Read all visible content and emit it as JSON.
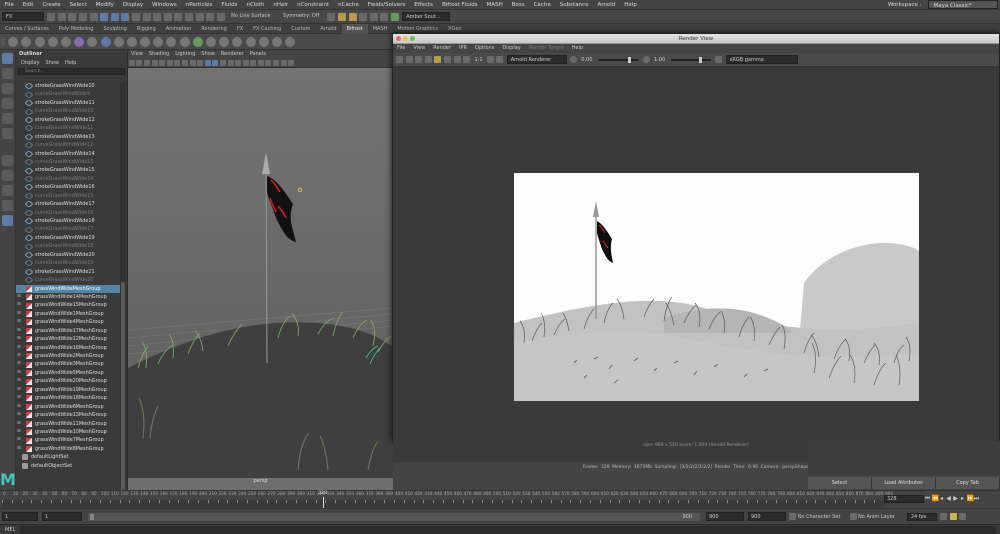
{
  "menubar": {
    "items": [
      "File",
      "Edit",
      "Create",
      "Select",
      "Modify",
      "Display",
      "Windows",
      "nParticles",
      "Fluids",
      "nCloth",
      "nHair",
      "nConstraint",
      "nCache",
      "Fields/Solvers",
      "Effects",
      "Bifrost Fluids",
      "MASH",
      "Boss",
      "Cache",
      "Substance",
      "Arnold",
      "Help"
    ],
    "workspace_label": "Workspace :",
    "workspace_value": "Maya Classic*"
  },
  "statusline": {
    "menuset": "FX",
    "live_surface": "No Live Surface",
    "symmetry": "Symmetry: Off",
    "camera_field": "Amber Sout..."
  },
  "shelf": {
    "tabs": [
      "Curves / Surfaces",
      "Poly Modeling",
      "Sculpting",
      "Rigging",
      "Animation",
      "Rendering",
      "FX",
      "FX Caching",
      "Custom",
      "Arnold",
      "Bifrost",
      "MASH",
      "Motion Graphics",
      "XGen"
    ],
    "active_tab": "Bifrost"
  },
  "outliner": {
    "title": "Outliner",
    "menu": [
      "Display",
      "Show",
      "Help"
    ],
    "search_placeholder": "Search...",
    "items": [
      {
        "label": "strokeGrassWindWide10",
        "kind": "curve",
        "dim": false
      },
      {
        "label": "curveGrassWindWide9",
        "kind": "curve",
        "dim": true
      },
      {
        "label": "strokeGrassWindWide11",
        "kind": "curve",
        "dim": false
      },
      {
        "label": "curveGrassWindWide10",
        "kind": "curve",
        "dim": true
      },
      {
        "label": "strokeGrassWindWide12",
        "kind": "curve",
        "dim": false
      },
      {
        "label": "curveGrassWindWide11",
        "kind": "curve",
        "dim": true
      },
      {
        "label": "strokeGrassWindWide13",
        "kind": "curve",
        "dim": false
      },
      {
        "label": "curveGrassWindWide12",
        "kind": "curve",
        "dim": true
      },
      {
        "label": "strokeGrassWindWide14",
        "kind": "curve",
        "dim": false
      },
      {
        "label": "curveGrassWindWide13",
        "kind": "curve",
        "dim": true
      },
      {
        "label": "strokeGrassWindWide15",
        "kind": "curve",
        "dim": false
      },
      {
        "label": "curveGrassWindWide14",
        "kind": "curve",
        "dim": true
      },
      {
        "label": "strokeGrassWindWide16",
        "kind": "curve",
        "dim": false
      },
      {
        "label": "curveGrassWindWide15",
        "kind": "curve",
        "dim": true
      },
      {
        "label": "strokeGrassWindWide17",
        "kind": "curve",
        "dim": false
      },
      {
        "label": "curveGrassWindWide16",
        "kind": "curve",
        "dim": true
      },
      {
        "label": "strokeGrassWindWide18",
        "kind": "curve",
        "dim": false
      },
      {
        "label": "curveGrassWindWide17",
        "kind": "curve",
        "dim": true
      },
      {
        "label": "strokeGrassWindWide19",
        "kind": "curve",
        "dim": false
      },
      {
        "label": "curveGrassWindWide18",
        "kind": "curve",
        "dim": true
      },
      {
        "label": "strokeGrassWindWide20",
        "kind": "curve",
        "dim": false
      },
      {
        "label": "curveGrassWindWide19",
        "kind": "curve",
        "dim": true
      },
      {
        "label": "strokeGrassWindWide21",
        "kind": "curve",
        "dim": false
      },
      {
        "label": "curveGrassWindWide20",
        "kind": "curve",
        "dim": true
      },
      {
        "label": "grassWindWideMeshGroup",
        "kind": "mesh",
        "dim": false,
        "selected": true
      },
      {
        "label": "grassWindWide14MeshGroup",
        "kind": "mesh",
        "dim": false,
        "expandable": true
      },
      {
        "label": "grassWindWide15MeshGroup",
        "kind": "mesh",
        "dim": false,
        "expandable": true
      },
      {
        "label": "grassWindWide1MeshGroup",
        "kind": "mesh",
        "dim": false,
        "expandable": true
      },
      {
        "label": "grassWindWide4MeshGroup",
        "kind": "mesh",
        "dim": false,
        "expandable": true
      },
      {
        "label": "grassWindWide17MeshGroup",
        "kind": "mesh",
        "dim": false,
        "expandable": true
      },
      {
        "label": "grassWindWide12MeshGroup",
        "kind": "mesh",
        "dim": false,
        "expandable": true
      },
      {
        "label": "grassWindWide16MeshGroup",
        "kind": "mesh",
        "dim": false,
        "expandable": true
      },
      {
        "label": "grassWindWide2MeshGroup",
        "kind": "mesh",
        "dim": false,
        "expandable": true
      },
      {
        "label": "grassWindWide3MeshGroup",
        "kind": "mesh",
        "dim": false,
        "expandable": true
      },
      {
        "label": "grassWindWide5MeshGroup",
        "kind": "mesh",
        "dim": false,
        "expandable": true
      },
      {
        "label": "grassWindWide20MeshGroup",
        "kind": "mesh",
        "dim": false,
        "expandable": true
      },
      {
        "label": "grassWindWide19MeshGroup",
        "kind": "mesh",
        "dim": false,
        "expandable": true
      },
      {
        "label": "grassWindWide18MeshGroup",
        "kind": "mesh",
        "dim": false,
        "expandable": true
      },
      {
        "label": "grassWindWide6MeshGroup",
        "kind": "mesh",
        "dim": false,
        "expandable": true
      },
      {
        "label": "grassWindWide13MeshGroup",
        "kind": "mesh",
        "dim": false,
        "expandable": true
      },
      {
        "label": "grassWindWide11MeshGroup",
        "kind": "mesh",
        "dim": false,
        "expandable": true
      },
      {
        "label": "grassWindWide10MeshGroup",
        "kind": "mesh",
        "dim": false,
        "expandable": true
      },
      {
        "label": "grassWindWide7MeshGroup",
        "kind": "mesh",
        "dim": false,
        "expandable": true
      },
      {
        "label": "grassWindWide8MeshGroup",
        "kind": "mesh",
        "dim": false,
        "expandable": true
      },
      {
        "label": "defaultLightSet",
        "kind": "set",
        "dim": false
      },
      {
        "label": "defaultObjectSet",
        "kind": "set",
        "dim": false
      }
    ]
  },
  "viewport": {
    "menu": [
      "View",
      "Shading",
      "Lighting",
      "Show",
      "Renderer",
      "Panels"
    ],
    "camera_label": "persp"
  },
  "render_view": {
    "title": "Render View",
    "menu": [
      "File",
      "View",
      "Render",
      "IPR",
      "Options",
      "Display",
      "Render Target",
      "Help"
    ],
    "disabled_menu": "Render Target",
    "ratio": "1:1",
    "renderer": "Arnold Renderer",
    "exposure": "0.00",
    "gamma": "1.00",
    "color_space": "sRGB gamma",
    "info_line": "size: 960 x 540  zoom: 1.000     (Arnold Renderer)",
    "status_line": "Frame: 328   Memory: 1875Mb   Sampling: [3/2/2/2/2/2/2]   Render Time: 0:90   Camera: perspShape"
  },
  "channel_box": {
    "buttons": [
      "Select",
      "Load Attributes",
      "Copy Tab"
    ]
  },
  "timeline": {
    "ticks": [
      "0",
      "10",
      "20",
      "30",
      "40",
      "50",
      "60",
      "70",
      "80",
      "90",
      "100",
      "110",
      "120",
      "130",
      "140",
      "150",
      "160",
      "170",
      "180",
      "190",
      "200",
      "210",
      "220",
      "230",
      "240",
      "250",
      "260",
      "270",
      "280",
      "290",
      "300",
      "310",
      "320",
      "330",
      "340",
      "350",
      "360",
      "370",
      "380",
      "390",
      "400",
      "410",
      "420",
      "430",
      "440",
      "450",
      "460",
      "470",
      "480",
      "490",
      "500",
      "510",
      "520",
      "530",
      "540",
      "550",
      "560",
      "570",
      "580",
      "590",
      "600",
      "610",
      "620",
      "630",
      "640",
      "650",
      "660",
      "670",
      "680",
      "690",
      "700",
      "710",
      "720",
      "730",
      "740",
      "750",
      "760",
      "770",
      "780",
      "790",
      "800",
      "810",
      "820",
      "830",
      "840",
      "850",
      "860",
      "870",
      "880",
      "890",
      "900"
    ],
    "current_frame": "328",
    "current_frame_field": "328"
  },
  "range": {
    "start": "1",
    "anim_start": "1",
    "anim_end_marker": "900",
    "end": "900",
    "anim_end": "900",
    "character_set": "No Character Set",
    "anim_layer": "No Anim Layer",
    "fps": "24 fps"
  },
  "command_line": {
    "mode": "MEL"
  },
  "colors": {
    "selection": "#5285a6",
    "accent_cyan": "#46c4c0"
  }
}
